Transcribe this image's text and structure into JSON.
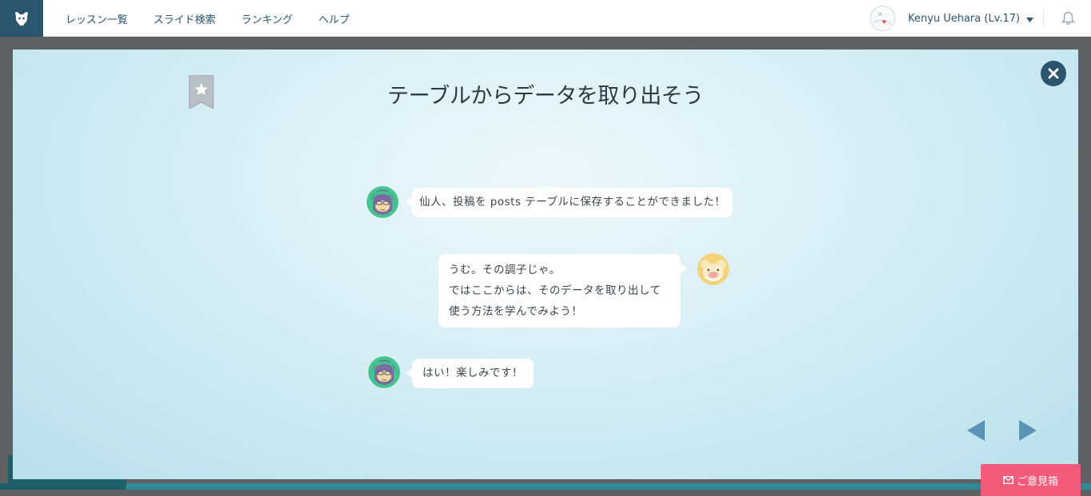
{
  "header": {
    "nav": [
      {
        "label": "レッスン一覧"
      },
      {
        "label": "スライド検索"
      },
      {
        "label": "ランキング"
      },
      {
        "label": "ヘルプ"
      }
    ],
    "user": {
      "name": "Kenyu Uehara (Lv.17)"
    }
  },
  "modal": {
    "title": "テーブルからデータを取り出そう",
    "messages": [
      {
        "speaker": "student",
        "lines": [
          "仙人、投稿を posts テーブルに保存することができました！"
        ]
      },
      {
        "speaker": "sensei",
        "lines": [
          "うむ。その調子じゃ。",
          "ではここからは、そのデータを取り出して",
          "使う方法を学んでみよう！"
        ]
      },
      {
        "speaker": "student",
        "lines": [
          "はい！楽しみです！"
        ]
      }
    ]
  },
  "feedback": {
    "label": "ご意見箱"
  },
  "colors": {
    "brand_navy": "#2b546e",
    "modal_bg": "#d7eef5",
    "feedback_pink": "#f45b7a",
    "arrow_blue": "#5b93b8"
  },
  "icons": [
    "logo-icon",
    "user-avatar",
    "caret-down-icon",
    "bell-icon",
    "bookmark-star-icon",
    "close-icon",
    "student-avatar",
    "sensei-avatar",
    "prev-arrow-icon",
    "next-arrow-icon",
    "mail-icon"
  ]
}
